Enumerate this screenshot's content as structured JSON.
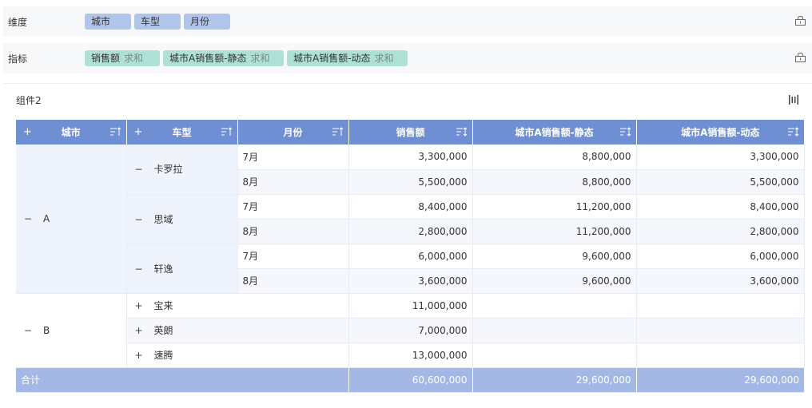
{
  "dimension": {
    "label": "维度",
    "fields": [
      "城市",
      "车型",
      "月份"
    ]
  },
  "metric": {
    "label": "指标",
    "fields": [
      {
        "name": "销售额",
        "agg": "求和"
      },
      {
        "name": "城市A销售额-静态",
        "agg": "求和"
      },
      {
        "name": "城市A销售额-动态",
        "agg": "求和"
      }
    ]
  },
  "component": {
    "title": "组件2"
  },
  "colors": {
    "header": "#6f8fd2",
    "total": "#a3b8e4",
    "dim_tag": "#b1c4ea",
    "metric_tag": "#aee0d6"
  },
  "icons": {
    "plus": "+",
    "minus": "−",
    "lock": "lock-icon",
    "sort": "sort-icon",
    "layout": "column-layout-icon"
  },
  "table": {
    "headers": {
      "city": "城市",
      "car": "车型",
      "month": "月份",
      "sales": "销售额",
      "static": "城市A销售额-静态",
      "dynamic": "城市A销售额-动态"
    },
    "cityA": {
      "name": "A",
      "cars": [
        {
          "name": "卡罗拉",
          "rows": [
            {
              "month": "7月",
              "sales": "3,300,000",
              "static": "8,800,000",
              "dynamic": "3,300,000"
            },
            {
              "month": "8月",
              "sales": "5,500,000",
              "static": "8,800,000",
              "dynamic": "5,500,000"
            }
          ]
        },
        {
          "name": "思域",
          "rows": [
            {
              "month": "7月",
              "sales": "8,400,000",
              "static": "11,200,000",
              "dynamic": "8,400,000"
            },
            {
              "month": "8月",
              "sales": "2,800,000",
              "static": "11,200,000",
              "dynamic": "2,800,000"
            }
          ]
        },
        {
          "name": "轩逸",
          "rows": [
            {
              "month": "7月",
              "sales": "6,000,000",
              "static": "9,600,000",
              "dynamic": "6,000,000"
            },
            {
              "month": "8月",
              "sales": "3,600,000",
              "static": "9,600,000",
              "dynamic": "3,600,000"
            }
          ]
        }
      ]
    },
    "cityB": {
      "name": "B",
      "cars": [
        {
          "name": "宝来",
          "sales": "11,000,000"
        },
        {
          "name": "英朗",
          "sales": "7,000,000"
        },
        {
          "name": "速腾",
          "sales": "13,000,000"
        }
      ]
    },
    "total": {
      "label": "合计",
      "sales": "60,600,000",
      "static": "29,600,000",
      "dynamic": "29,600,000"
    }
  }
}
